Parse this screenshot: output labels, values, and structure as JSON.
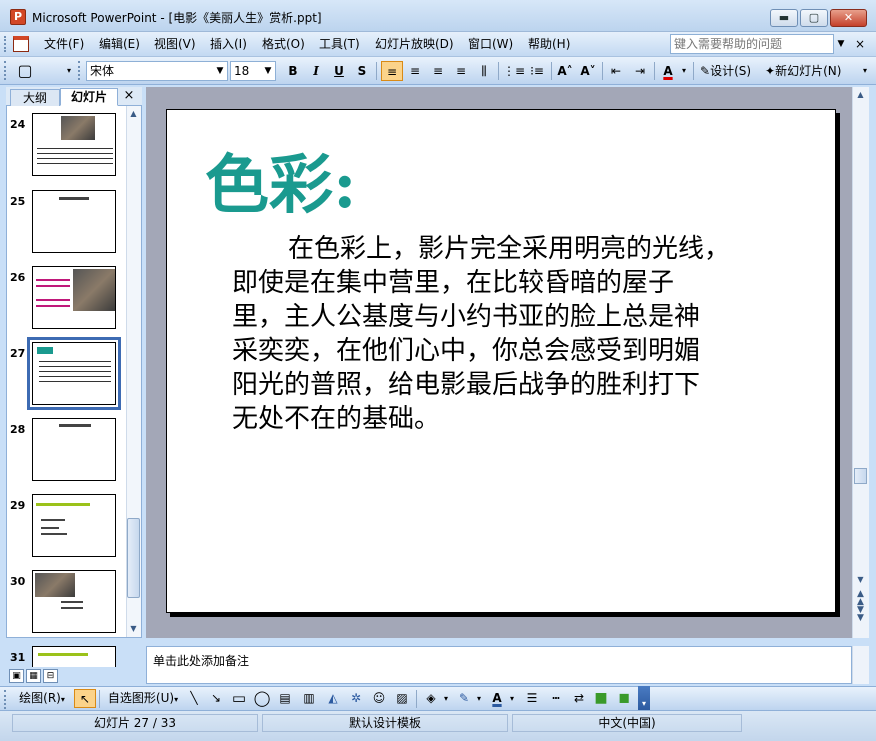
{
  "window": {
    "title": "Microsoft PowerPoint - [电影《美丽人生》赏析.ppt]",
    "app_icon": "P",
    "min_glyph": "▬",
    "max_glyph": "▢",
    "close_glyph": "✕"
  },
  "menu": {
    "items": [
      "文件(F)",
      "编辑(E)",
      "视图(V)",
      "插入(I)",
      "格式(O)",
      "工具(T)",
      "幻灯片放映(D)",
      "窗口(W)",
      "帮助(H)"
    ],
    "help_placeholder": "键入需要帮助的问题",
    "close_glyph": "×"
  },
  "toolbar": {
    "new_glyph": "▢",
    "font": "宋体",
    "size": "18",
    "bold": "B",
    "italic": "I",
    "underline": "U",
    "shadow": "S",
    "align_left": "≡",
    "align_center": "≡",
    "align_right": "≡",
    "justify": "≡",
    "distributed": "⫼",
    "numbering": "⋮≡",
    "bullets": "⁝≡",
    "grow_font": "A˄",
    "shrink_font": "A˅",
    "decrease_indent": "⇤",
    "increase_indent": "⇥",
    "font_color": "A",
    "design_label": "设计(S)",
    "new_slide_label": "新幻灯片(N)"
  },
  "left_panel": {
    "tabs": [
      "大纲",
      "幻灯片"
    ],
    "close_glyph": "×",
    "thumbnails": [
      {
        "num": "24"
      },
      {
        "num": "25"
      },
      {
        "num": "26"
      },
      {
        "num": "27"
      },
      {
        "num": "28"
      },
      {
        "num": "29"
      },
      {
        "num": "30"
      },
      {
        "num": "31"
      }
    ]
  },
  "slide": {
    "title": "色彩:",
    "body": "在色彩上，影片完全采用明亮的光线，即使是在集中营里，在比较昏暗的屋子里，主人公基度与小约书亚的脸上总是神采奕奕，在他们心中，你总会感受到明媚阳光的普照，给电影最后战争的胜利打下无处不在的基础。",
    "body_lines": [
      "在色彩上，影片完全采用明亮的光线，",
      "即使是在集中营里，在比较昏暗的屋子",
      "里，主人公基度与小约书亚的脸上总是神",
      "采奕奕，在他们心中，你总会感受到明媚",
      "阳光的普照，给电影最后战争的胜利打下",
      "无处不在的基础。"
    ],
    "title_color": "#1a9a8f"
  },
  "notes": {
    "placeholder": "单击此处添加备注"
  },
  "drawing": {
    "draw_label": "绘图(R)",
    "autoshapes_label": "自选图形(U)"
  },
  "status": {
    "slide_info": "幻灯片 27 / 33",
    "template": "默认设计模板",
    "language": "中文(中国)"
  }
}
